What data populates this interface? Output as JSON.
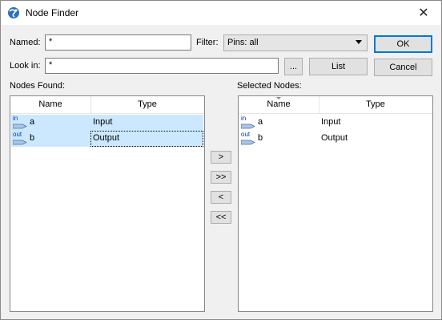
{
  "window": {
    "title": "Node Finder",
    "close_glyph": "✕",
    "icon": "globe-app-icon"
  },
  "form": {
    "named_label": "Named:",
    "named_value": "*",
    "filter_label": "Filter:",
    "filter_value": "Pins: all",
    "lookin_label": "Look in:",
    "lookin_value": "*",
    "browse_label": "...",
    "list_label": "List",
    "ok_label": "OK",
    "cancel_label": "Cancel"
  },
  "found": {
    "label": "Nodes Found:",
    "columns": [
      "Name",
      "Type"
    ],
    "rows": [
      {
        "pin": "in",
        "name": "a",
        "type": "Input",
        "selected": true
      },
      {
        "pin": "out",
        "name": "b",
        "type": "Output",
        "selected": true
      }
    ]
  },
  "selected": {
    "label": "Selected Nodes:",
    "columns": [
      "Name",
      "Type"
    ],
    "rows": [
      {
        "pin": "in",
        "name": "a",
        "type": "Input"
      },
      {
        "pin": "out",
        "name": "b",
        "type": "Output"
      }
    ]
  },
  "transfer": {
    "add": ">",
    "add_all": ">>",
    "remove": "<",
    "remove_all": "<<"
  },
  "colors": {
    "selection": "#cce8ff",
    "accent": "#0078d7",
    "pin_tag": "#0033cc"
  }
}
